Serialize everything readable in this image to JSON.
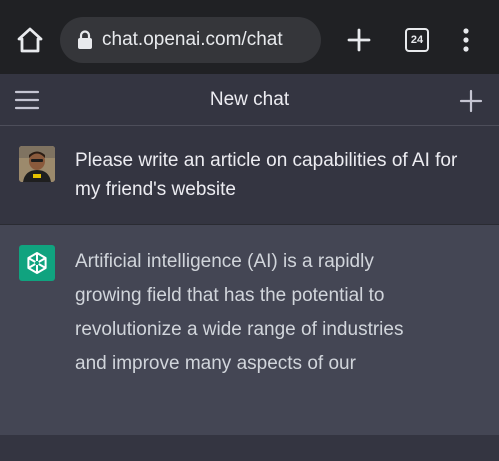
{
  "browser": {
    "url": "chat.openai.com/chat",
    "tab_count": "24"
  },
  "header": {
    "title": "New chat"
  },
  "messages": {
    "user": {
      "text": "Please write an article on capabilities of AI for my friend's website"
    },
    "assistant": {
      "text": "Artificial intelligence (AI) is a rapidly growing field that has the potential to revolutionize a wide range of industries and improve many aspects of our"
    }
  },
  "icons": {
    "home": "home-icon",
    "lock": "lock-icon",
    "new_tab": "plus-icon",
    "tabs": "tab-switcher-icon",
    "menu": "more-vert-icon",
    "hamburger": "hamburger-menu-icon",
    "new_chat": "plus-icon",
    "assistant_logo": "openai-logo-icon"
  },
  "colors": {
    "browser_bar": "#202124",
    "app_background": "#343541",
    "assistant_background": "#444654",
    "assistant_avatar": "#10a37f"
  }
}
